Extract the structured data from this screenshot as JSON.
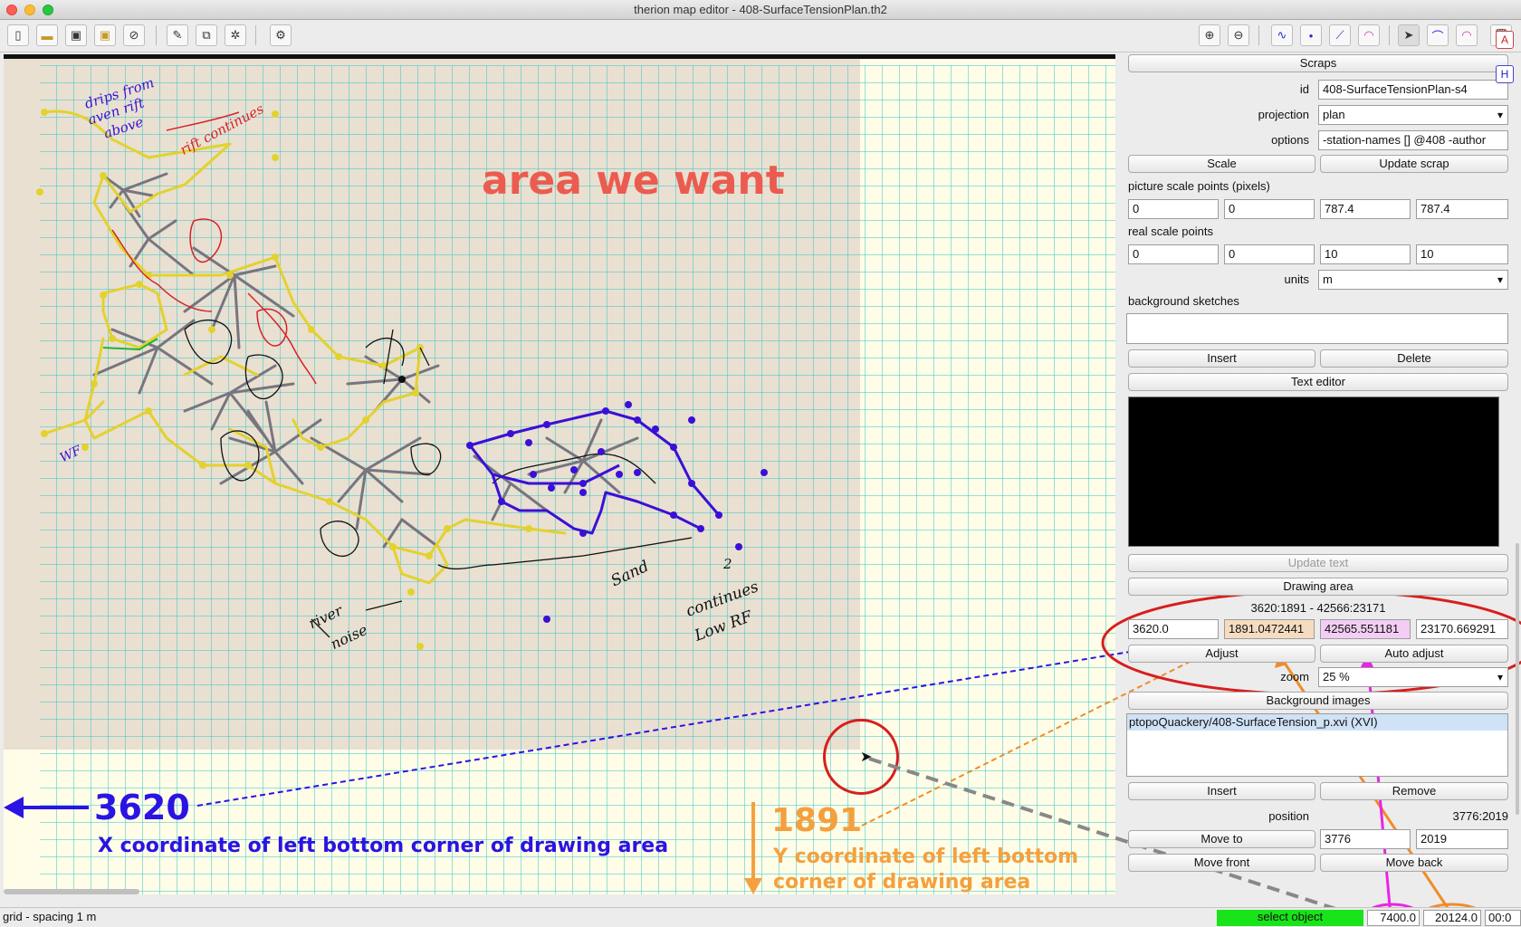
{
  "window": {
    "title": "therion map editor - 408-SurfaceTensionPlan.th2"
  },
  "toolbar": {
    "left_icons": [
      "new-file-icon",
      "open-folder-icon",
      "save-icon",
      "save-as-icon",
      "close-icon",
      "edit-icon",
      "import-icon",
      "settings-sheet-icon",
      "gear-icon"
    ],
    "right_icons": [
      "zoom-in-icon",
      "zoom-out-icon",
      "insert-line-icon",
      "insert-point-icon",
      "insert-link-icon",
      "insert-area-icon",
      "select-arrow-icon",
      "edit-line-icon",
      "area-edit-icon",
      "trash-icon"
    ]
  },
  "canvas": {
    "area_label": "area we want",
    "sketch_words": [
      "drips from",
      "aven rift",
      "above",
      "rift continues",
      "WF",
      "river",
      "noise",
      "Sand",
      "continues",
      "Low RF",
      "2"
    ],
    "colors": {
      "grid": "#2ec4c9",
      "area": "#e9e0d1",
      "yellow_line": "#e3d12f",
      "gray_line": "#77757f",
      "blue_line": "#3a10d6",
      "red_line": "#d82027"
    }
  },
  "annotations": {
    "x_value": "3620",
    "x_caption": "X coordinate of left bottom corner of drawing area",
    "y_value": "1891",
    "y_caption_line1": "Y coordinate of left bottom",
    "y_caption_line2": "corner of drawing area",
    "colors": {
      "area_text": "#ec5b4f",
      "x_color": "#2b13e3",
      "y_color": "#f4a03e",
      "ring_red": "#d81e1e",
      "magenta": "#ea24e6",
      "orange": "#f08c28"
    }
  },
  "panel": {
    "scraps_label": "Scraps",
    "id_label": "id",
    "id_value": "408-SurfaceTensionPlan-s4",
    "projection_label": "projection",
    "projection_value": "plan",
    "options_label": "options",
    "options_value": "-station-names [] @408 -author",
    "scale_button": "Scale",
    "update_scrap_button": "Update scrap",
    "picture_scale_label": "picture scale points (pixels)",
    "picture_scale_values": [
      "0",
      "0",
      "787.4",
      "787.4"
    ],
    "real_scale_label": "real scale points",
    "real_scale_values": [
      "0",
      "0",
      "10",
      "10"
    ],
    "units_label": "units",
    "units_value": "m",
    "bg_sketches_label": "background sketches",
    "insert_button": "Insert",
    "delete_button": "Delete",
    "text_editor_button": "Text editor",
    "update_text_button": "Update text",
    "drawing_area_button": "Drawing area",
    "drawing_area_summary": "3620:1891 - 42566:23171",
    "drawing_area_values": [
      "3620.0",
      "1891.0472441",
      "42565.551181",
      "23170.669291"
    ],
    "adjust_button": "Adjust",
    "auto_adjust_button": "Auto adjust",
    "zoom_label": "zoom",
    "zoom_value": "25 %",
    "bg_images_button": "Background images",
    "bg_image_item": "ptopoQuackery/408-SurfaceTension_p.xvi (XVI)",
    "insert2_button": "Insert",
    "remove_button": "Remove",
    "position_label": "position",
    "position_summary": "3776:2019",
    "move_to_button": "Move to",
    "move_x": "3776",
    "move_y": "2019",
    "move_front_button": "Move front",
    "move_back_button": "Move back"
  },
  "status": {
    "grid_text": "grid - spacing 1 m",
    "mode_text": "select object",
    "mode_color": "#19e419",
    "x_coord": "7400.0",
    "y_coord": "20124.0",
    "time_text": "00:0"
  }
}
